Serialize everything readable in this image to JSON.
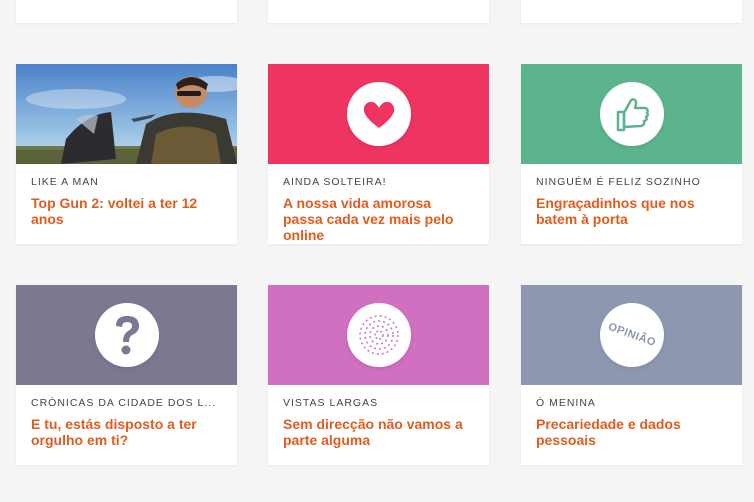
{
  "colors": {
    "title": "#e05c1f",
    "category": "#444444",
    "background": "#f5f5f5",
    "love_bg": "#ee3561",
    "thumbs_bg": "#5cb48e",
    "question_bg": "#7b7891",
    "spiral_bg": "#d070c0",
    "opinion_bg": "#8d97b0"
  },
  "cards": [
    {
      "category": "LIKE A MAN",
      "title": "Top Gun 2: voltei a ter 12 anos",
      "media": "photo-man-on-motorcycle"
    },
    {
      "category": "AINDA SOLTEIRA!",
      "title": "A nossa vida amorosa passa cada vez mais pelo online",
      "media": "heart-icon"
    },
    {
      "category": "NINGUÉM É FELIZ SOZINHO",
      "title": "Engraçadinhos que nos batem à porta",
      "media": "thumbs-up-icon"
    },
    {
      "category": "CRÓNICAS DA CIDADE DOS L...",
      "title": "E tu, estás disposto a ter orgulho em ti?",
      "media": "question-mark-icon"
    },
    {
      "category": "VISTAS LARGAS",
      "title": "Sem direcção não vamos a parte alguma",
      "media": "spiral-icon"
    },
    {
      "category": "Ó MENINA",
      "title": "Precariedade e dados pessoais",
      "media": "opinion-badge",
      "badge_text": "OPINIÃO"
    }
  ],
  "top_cards": [
    {
      "title": "partial-card"
    },
    {
      "title": "partial-card"
    },
    {
      "title": "partial-card"
    }
  ]
}
